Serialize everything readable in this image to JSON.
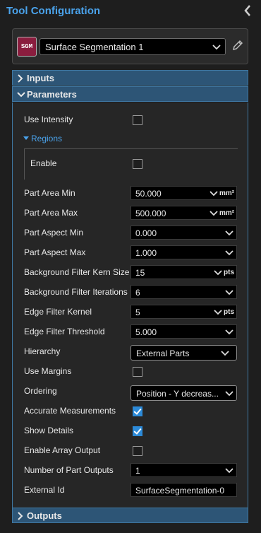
{
  "header": {
    "title": "Tool Configuration"
  },
  "tool": {
    "icon_text": "SGM",
    "selected": "Surface Segmentation 1"
  },
  "sections": {
    "inputs": "Inputs",
    "parameters": "Parameters",
    "outputs": "Outputs"
  },
  "params": {
    "use_intensity": {
      "label": "Use Intensity",
      "checked": false
    },
    "regions": {
      "label": "Regions",
      "enable_label": "Enable",
      "enable_checked": false
    },
    "part_area_min": {
      "label": "Part Area Min",
      "value": "50.000",
      "unit": "mm²"
    },
    "part_area_max": {
      "label": "Part Area Max",
      "value": "500.000",
      "unit": "mm²"
    },
    "part_aspect_min": {
      "label": "Part Aspect Min",
      "value": "0.000"
    },
    "part_aspect_max": {
      "label": "Part Aspect Max",
      "value": "1.000"
    },
    "bg_filter_kern": {
      "label": "Background Filter Kern Size",
      "value": "15",
      "unit": "pts"
    },
    "bg_filter_iter": {
      "label": "Background Filter Iterations",
      "value": "6"
    },
    "edge_filter_kernel": {
      "label": "Edge Filter Kernel",
      "value": "5",
      "unit": "pts"
    },
    "edge_filter_threshold": {
      "label": "Edge Filter Threshold",
      "value": "5.000"
    },
    "hierarchy": {
      "label": "Hierarchy",
      "value": "External Parts"
    },
    "use_margins": {
      "label": "Use Margins",
      "checked": false
    },
    "ordering": {
      "label": "Ordering",
      "value": "Position - Y decreas..."
    },
    "accurate_measurements": {
      "label": "Accurate Measurements",
      "checked": true
    },
    "show_details": {
      "label": "Show Details",
      "checked": true
    },
    "enable_array_output": {
      "label": "Enable Array Output",
      "checked": false
    },
    "num_part_outputs": {
      "label": "Number of Part Outputs",
      "value": "1"
    },
    "external_id": {
      "label": "External Id",
      "value": "SurfaceSegmentation-0"
    }
  },
  "colors": {
    "accent": "#4aa3ec",
    "section_bg": "#2d5576",
    "checkbox_on": "#2c8ad8",
    "tool_icon_bg": "#8a1d3e"
  }
}
